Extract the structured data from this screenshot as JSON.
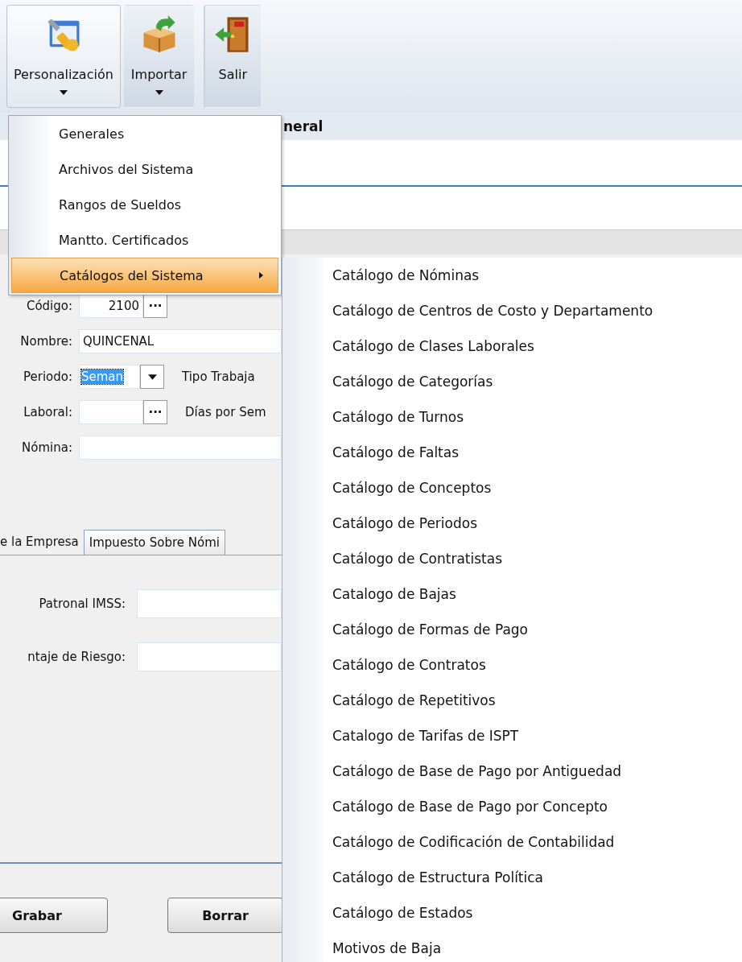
{
  "ribbon": {
    "buttons": [
      {
        "label": "Personalización",
        "kind": "settings",
        "dropdown": true,
        "selected": true
      },
      {
        "label": "Importar",
        "kind": "import",
        "dropdown": true,
        "selected": false
      },
      {
        "label": "Salir",
        "kind": "exit",
        "dropdown": false,
        "selected": false
      }
    ],
    "group_label": "neral"
  },
  "form": {
    "rows": [
      {
        "label": "Código:",
        "kind": "lookup",
        "value": "2100",
        "lookup_button": "···"
      },
      {
        "label": "Nombre:",
        "kind": "text",
        "value": "QUINCENAL"
      },
      {
        "label": "Periodo:",
        "kind": "combo",
        "value": "Seman",
        "side_label": "Tipo Trabaja"
      },
      {
        "label": "Laboral:",
        "kind": "lookup",
        "value": "",
        "lookup_button": "···",
        "side_label": "Días por Sem"
      },
      {
        "label": "Nómina:",
        "kind": "text",
        "value": ""
      }
    ],
    "tabs": [
      {
        "label": "e la Empresa",
        "selected": true
      },
      {
        "label": "Impuesto Sobre Nómi",
        "selected": false
      }
    ],
    "tab_fields": [
      {
        "label": "Patronal IMSS:"
      },
      {
        "label": "ntaje de Riesgo:"
      }
    ],
    "buttons": [
      "Grabar",
      "Borrar"
    ]
  },
  "menu": {
    "items": [
      {
        "label": "Generales",
        "selected": false,
        "submenu": false
      },
      {
        "label": "Archivos del Sistema",
        "selected": false,
        "submenu": false
      },
      {
        "label": "Rangos de Sueldos",
        "selected": false,
        "submenu": false
      },
      {
        "label": "Mantto. Certificados",
        "selected": false,
        "submenu": false
      },
      {
        "label": "Catálogos del Sistema",
        "selected": true,
        "submenu": true
      }
    ]
  },
  "submenu": {
    "items": [
      "Catálogo de Nóminas",
      "Catálogo de Centros de Costo y Departamento",
      "Catálogo de Clases Laborales",
      "Catálogo de Categorías",
      "Catálogo de Turnos",
      "Catálogo de Faltas",
      "Catálogo de Conceptos",
      "Catálogo de Periodos",
      "Catálogo de Contratistas",
      "Catalogo de Bajas",
      "Catálogo de Formas de Pago",
      "Catálogo de Contratos",
      "Catálogo de Repetitivos",
      "Catalogo de Tarifas de ISPT",
      "Catálogo de Base de Pago por Antiguedad",
      "Catálogo de Base de Pago por Concepto",
      "Catálogo de Codificación de Contabilidad",
      "Catálogo de Estructura Política",
      "Catálogo de Estados",
      "Motivos de Baja"
    ]
  }
}
